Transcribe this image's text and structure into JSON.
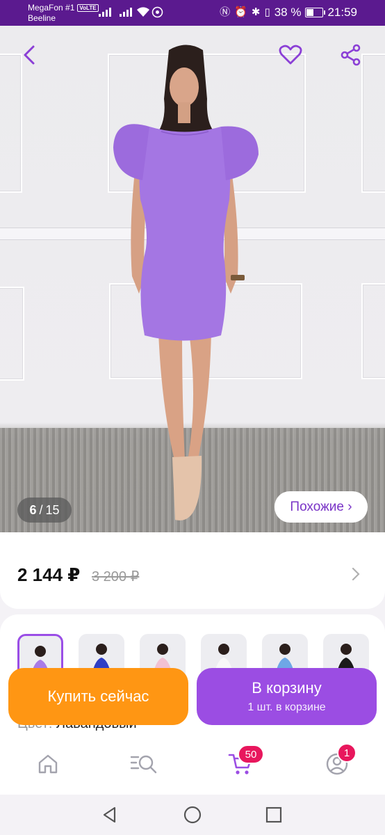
{
  "status_bar": {
    "carrier1": "MegaFon #1",
    "volte": "VoLTE",
    "carrier2": "Beeline",
    "battery": "38 %",
    "battery_level": 0.38,
    "time": "21:59",
    "icons": [
      "nfc-icon",
      "alarm-icon",
      "bluetooth-icon",
      "vibrate-icon",
      "wifi-icon",
      "whatsapp-icon"
    ]
  },
  "gallery": {
    "current": "6",
    "separator": "/",
    "total": "15",
    "similar_label": "Похожие ›"
  },
  "product": {
    "price": "2 144 ₽",
    "old_price": "3 200 ₽",
    "color_label": "Цвет:",
    "color_value": "Лавандовый",
    "variant_colors": [
      "#a97be6",
      "#2f3fc4",
      "#f2c1d3",
      "#f8f8f8",
      "#6ea7e6",
      "#1a1a1a"
    ]
  },
  "actions": {
    "buy_now": "Купить сейчас",
    "add_to_cart": "В корзину",
    "in_cart": "1 шт. в корзине"
  },
  "bottom_nav": {
    "cart_badge": "50",
    "profile_badge": "1"
  },
  "colors": {
    "accent": "#9b4de3",
    "orange": "#ff9613",
    "status_bar": "#5b1a8f",
    "badge": "#e8175d"
  }
}
